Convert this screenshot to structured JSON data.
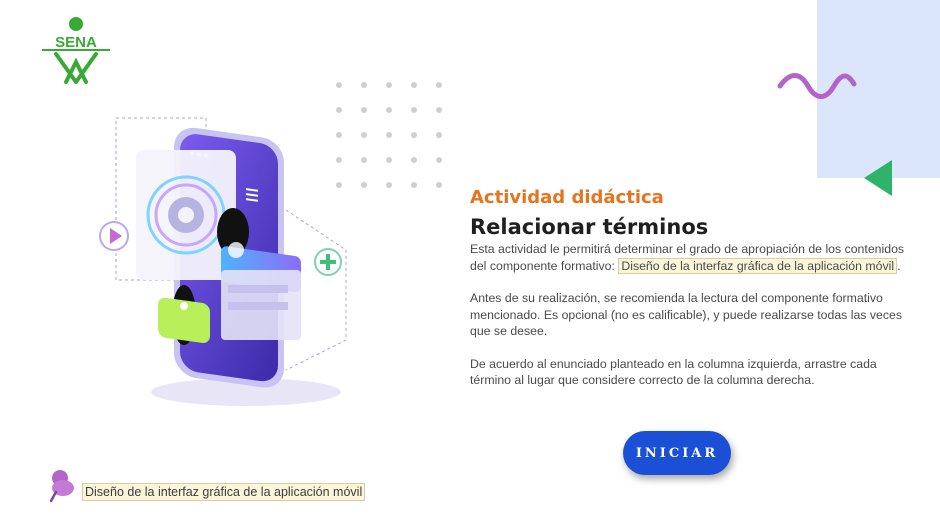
{
  "logo": {
    "text": "SENA"
  },
  "activity": {
    "kicker": "Actividad didáctica",
    "title": "Relacionar términos",
    "paragraph1_prefix": "Esta actividad le permitirá determinar el grado de apropiación de los contenidos del componente formativo: ",
    "paragraph1_highlight": "Diseño de la interfaz gráfica de la aplicación móvil",
    "paragraph1_suffix": ".",
    "paragraph2": "Antes de su realización, se recomienda la lectura del componente formativo mencionado.  Es opcional (no es calificable), y puede realizarse todas las veces que se desee.",
    "paragraph3": "De acuerdo al enunciado planteado en la columna izquierda, arrastre cada término al lugar que considere correcto de la columna derecha."
  },
  "start_button": {
    "label": "INICIAR"
  },
  "footer": {
    "link_text": "Diseño de la interfaz gráfica de la aplicación móvil"
  },
  "colors": {
    "accent_orange": "#e8731d",
    "button_blue": "#1a4fd6",
    "logo_green": "#39a935",
    "deco_purple": "#b464c8",
    "highlight_bg": "#fbf6d9"
  }
}
